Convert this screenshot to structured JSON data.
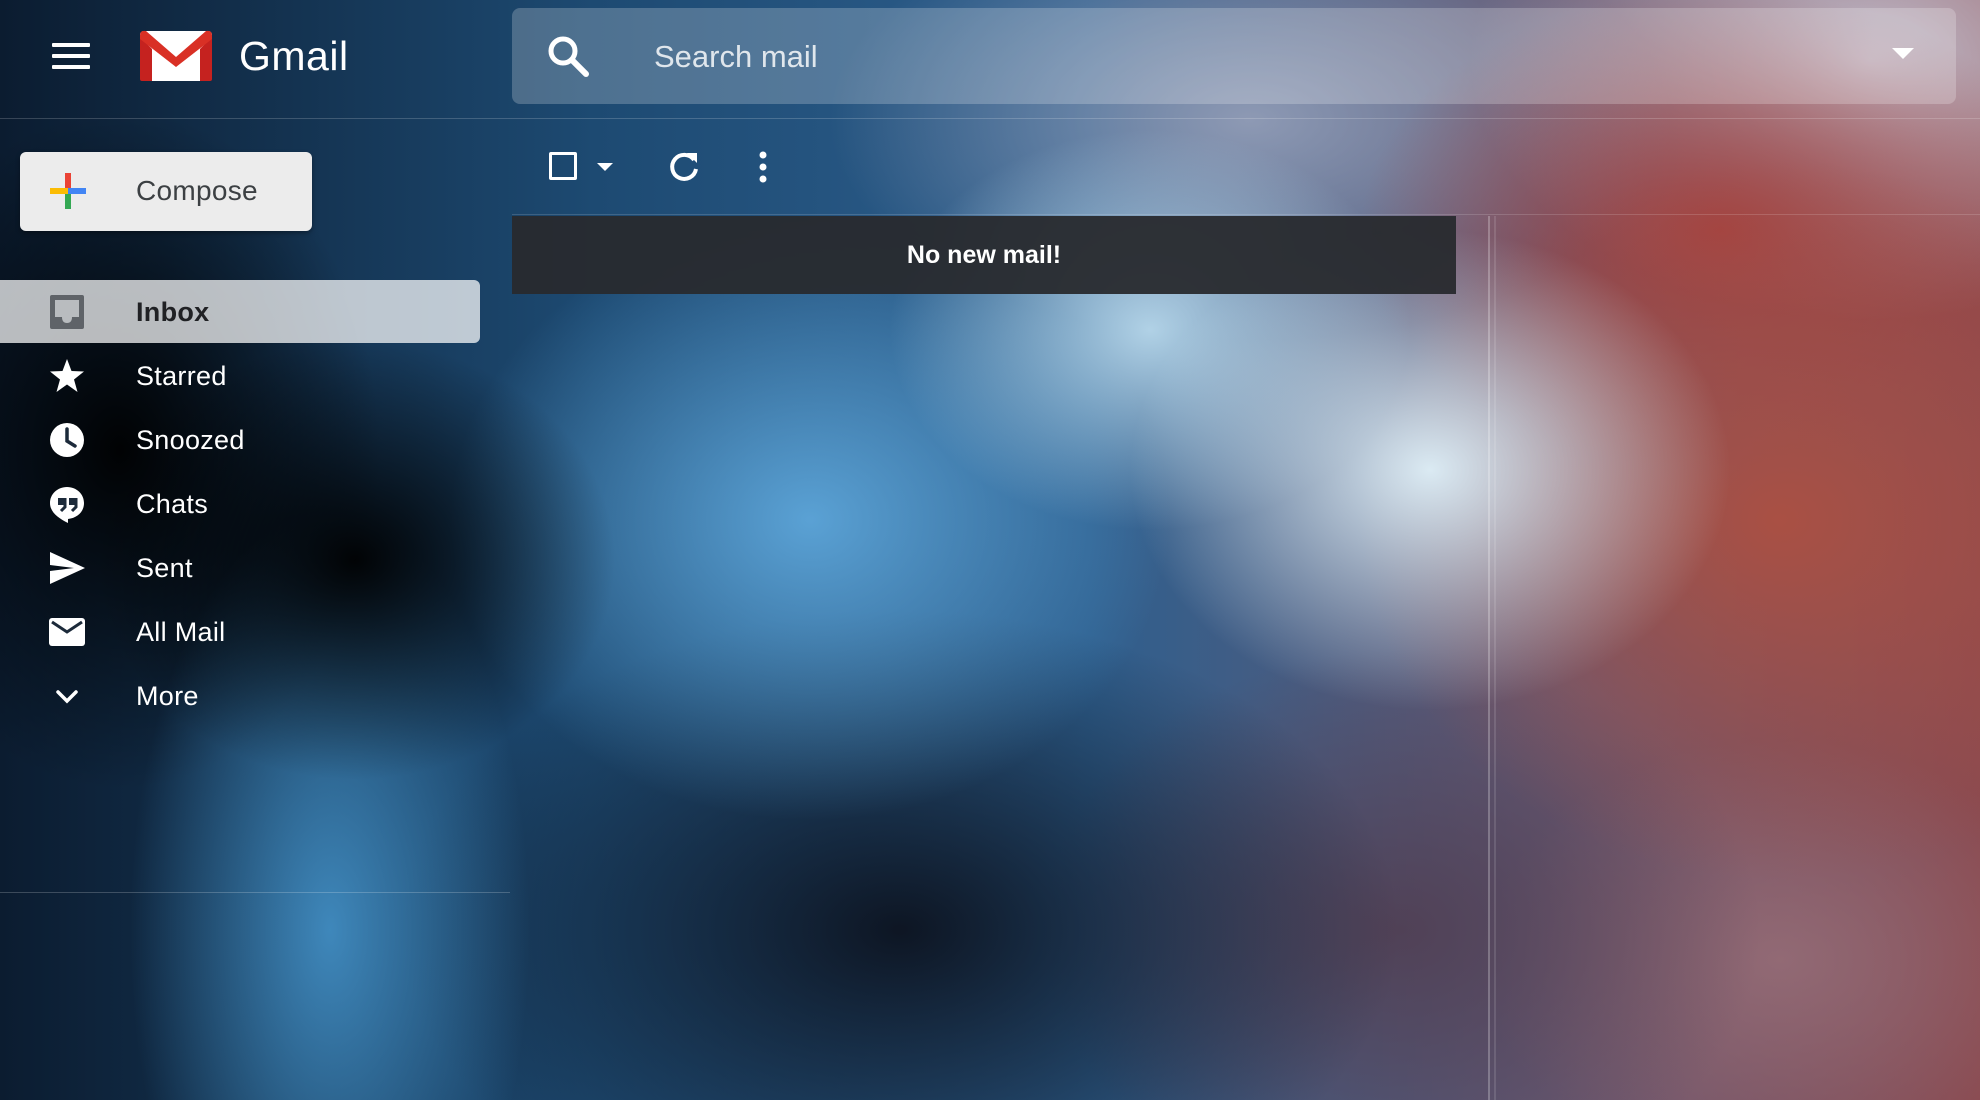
{
  "app": {
    "name": "Gmail"
  },
  "search": {
    "placeholder": "Search mail"
  },
  "compose": {
    "label": "Compose"
  },
  "sidebar": {
    "items": [
      {
        "label": "Inbox",
        "icon": "inbox-icon",
        "active": true
      },
      {
        "label": "Starred",
        "icon": "star-icon",
        "active": false
      },
      {
        "label": "Snoozed",
        "icon": "clock-icon",
        "active": false
      },
      {
        "label": "Chats",
        "icon": "chat-icon",
        "active": false
      },
      {
        "label": "Sent",
        "icon": "send-icon",
        "active": false
      },
      {
        "label": "All Mail",
        "icon": "mail-icon",
        "active": false
      },
      {
        "label": "More",
        "icon": "chevron-down-icon",
        "active": false
      }
    ]
  },
  "main": {
    "notice": "No new mail!"
  },
  "colors": {
    "logo_red": "#d93025",
    "compose_bg": "#ececec",
    "notice_bg": "#282a2e",
    "plus_blue": "#4285f4",
    "plus_red": "#ea4335",
    "plus_yellow": "#fbbc04",
    "plus_green": "#34a853"
  }
}
